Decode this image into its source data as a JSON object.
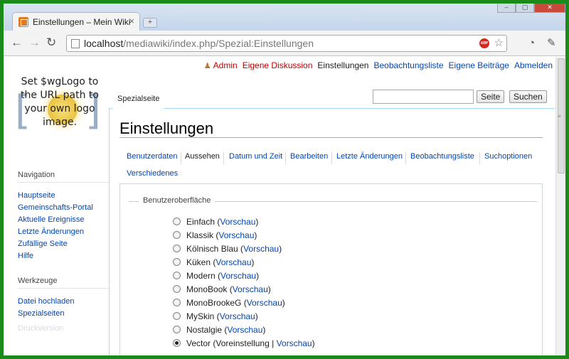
{
  "browser": {
    "tab_title": "Einstellungen – Mein Wiki",
    "tab_close": "×",
    "new_tab": "+",
    "url_host": "localhost",
    "url_path": "/mediawiki/index.php/Spezial:Einstellungen",
    "adblock_label": "ABP"
  },
  "personal_tools": {
    "user": "Admin",
    "talk": "Eigene Diskussion",
    "preferences": "Einstellungen",
    "watchlist": "Beobachtungsliste",
    "contributions": "Eigene Beiträge",
    "logout": "Abmelden"
  },
  "logo": {
    "text": "Set $wgLogo to the URL path to your own logo image."
  },
  "sidebar": {
    "nav_heading": "Navigation",
    "nav_items": [
      "Hauptseite",
      "Gemeinschafts-Portal",
      "Aktuelle Ereignisse",
      "Letzte Änderungen",
      "Zufällige Seite",
      "Hilfe"
    ],
    "tools_heading": "Werkzeuge",
    "tools_items": [
      "Datei hochladen",
      "Spezialseiten"
    ],
    "faint_item": "Druckversion"
  },
  "page_tab": "Spezialseite",
  "search": {
    "placeholder": "",
    "go_label": "Seite",
    "search_label": "Suchen"
  },
  "title": "Einstellungen",
  "pref_tabs": [
    "Benutzerdaten",
    "Aussehen",
    "Datum und Zeit",
    "Bearbeiten",
    "Letzte Änderungen",
    "Beobachtungsliste",
    "Suchoptionen",
    "Verschiedenes"
  ],
  "selected_pref_tab": "Aussehen",
  "skin_section": {
    "legend": "Benutzeroberfläche",
    "preview_label": "Vorschau",
    "skins": [
      {
        "name": "Einfach",
        "default": "",
        "selected": false
      },
      {
        "name": "Klassik",
        "default": "",
        "selected": false
      },
      {
        "name": "Kölnisch Blau",
        "default": "",
        "selected": false
      },
      {
        "name": "Küken",
        "default": "",
        "selected": false
      },
      {
        "name": "Modern",
        "default": "",
        "selected": false
      },
      {
        "name": "MonoBook",
        "default": "",
        "selected": false
      },
      {
        "name": "MonoBrookeG",
        "default": "",
        "selected": false
      },
      {
        "name": "MySkin",
        "default": "",
        "selected": false
      },
      {
        "name": "Nostalgie",
        "default": "",
        "selected": false
      },
      {
        "name": "Vector",
        "default": "Voreinstellung",
        "selected": true
      }
    ]
  },
  "colors": {
    "frame": "#1a8a1a",
    "link": "#0645ad",
    "link_new": "#ba0000",
    "tab_border": "#a7d7f9"
  }
}
